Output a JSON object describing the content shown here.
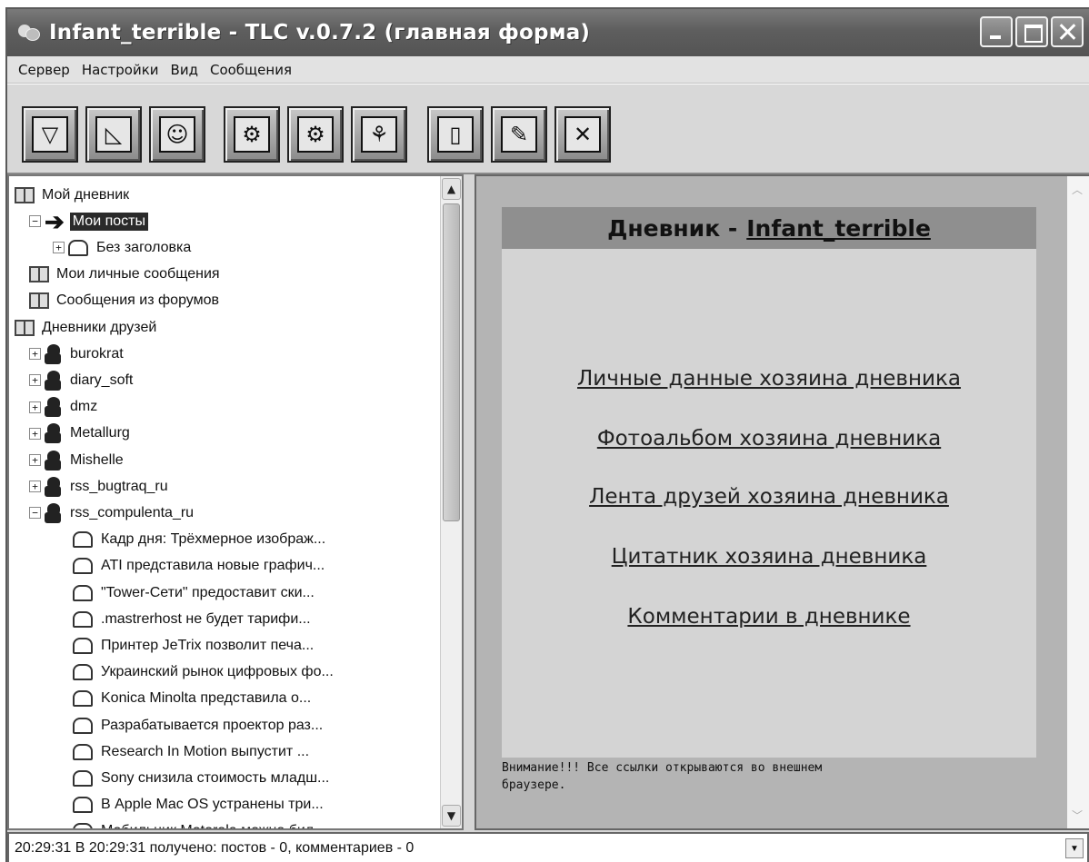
{
  "window": {
    "title": "Infant_terrible - TLC v.0.7.2 (главная форма)"
  },
  "menubar": {
    "items": [
      "Сервер",
      "Настройки",
      "Вид",
      "Сообщения"
    ]
  },
  "toolbar": {
    "buttons": [
      {
        "icon": "trash-icon",
        "glyph": "▽"
      },
      {
        "icon": "chart-icon",
        "glyph": "◺"
      },
      {
        "icon": "smiley-icon",
        "glyph": "☺"
      },
      {
        "icon": "settings-gears-icon",
        "glyph": "⚙"
      },
      {
        "icon": "settings-disk-icon",
        "glyph": "⚙"
      },
      {
        "icon": "users-icon",
        "glyph": "⚘"
      },
      {
        "icon": "new-document-icon",
        "glyph": "▯"
      },
      {
        "icon": "edit-document-icon",
        "glyph": "✎"
      },
      {
        "icon": "tools-icon",
        "glyph": "✕"
      }
    ]
  },
  "tree": {
    "items": [
      {
        "label": "Мой дневник",
        "icon": "book-icon",
        "level": 0,
        "expander": ""
      },
      {
        "label": "Мои посты",
        "icon": "arrow-icon",
        "level": 1,
        "expander": "−",
        "selected": true
      },
      {
        "label": "Без заголовка",
        "icon": "envelope-icon",
        "level": 2,
        "expander": "+"
      },
      {
        "label": "Мои личные сообщения",
        "icon": "book-icon",
        "level": 1,
        "expander": ""
      },
      {
        "label": "Сообщения из форумов",
        "icon": "book-icon",
        "level": 1,
        "expander": ""
      },
      {
        "label": "Дневники друзей",
        "icon": "book-icon",
        "level": 0,
        "expander": ""
      },
      {
        "label": "burokrat",
        "icon": "user-icon",
        "level": 1,
        "expander": "+"
      },
      {
        "label": "diary_soft",
        "icon": "user-icon",
        "level": 1,
        "expander": "+"
      },
      {
        "label": "dmz",
        "icon": "user-icon",
        "level": 1,
        "expander": "+"
      },
      {
        "label": "Metallurg",
        "icon": "user-icon",
        "level": 1,
        "expander": "+"
      },
      {
        "label": "Mishelle",
        "icon": "user-icon",
        "level": 1,
        "expander": "+"
      },
      {
        "label": "rss_bugtraq_ru",
        "icon": "user-icon",
        "level": 1,
        "expander": "+"
      },
      {
        "label": "rss_compulenta_ru",
        "icon": "user-icon",
        "level": 1,
        "expander": "−"
      },
      {
        "label": "Кадр дня: Трёхмерное изображ...",
        "icon": "envelope-icon",
        "level": 2,
        "expander": ""
      },
      {
        "label": "ATI представила новые графич...",
        "icon": "envelope-icon",
        "level": 2,
        "expander": ""
      },
      {
        "label": "\"Tower-Сети\" предоставит ски...",
        "icon": "envelope-icon",
        "level": 2,
        "expander": ""
      },
      {
        "label": ".mastrerhost не будет тарифи...",
        "icon": "envelope-icon",
        "level": 2,
        "expander": ""
      },
      {
        "label": "Принтер JeTrix позволит печа...",
        "icon": "envelope-icon",
        "level": 2,
        "expander": ""
      },
      {
        "label": "Украинский рынок цифровых фо...",
        "icon": "envelope-icon",
        "level": 2,
        "expander": ""
      },
      {
        "label": "Konica Minolta представила о...",
        "icon": "envelope-icon",
        "level": 2,
        "expander": ""
      },
      {
        "label": "Разрабатывается проектор раз...",
        "icon": "envelope-icon",
        "level": 2,
        "expander": ""
      },
      {
        "label": "Research In Motion выпустит ...",
        "icon": "envelope-icon",
        "level": 2,
        "expander": ""
      },
      {
        "label": "Sony снизила стоимость младш...",
        "icon": "envelope-icon",
        "level": 2,
        "expander": ""
      },
      {
        "label": "В Apple Mac OS устранены три...",
        "icon": "envelope-icon",
        "level": 2,
        "expander": ""
      },
      {
        "label": "Мобильник Motorola можно бил...",
        "icon": "envelope-icon",
        "level": 2,
        "expander": ""
      }
    ]
  },
  "diary": {
    "heading_prefix": "Дневник -",
    "owner": "Infant_terrible",
    "links": [
      "Личные данные хозяина дневника",
      "Фотоальбом хозяина дневника",
      "Лента друзей хозяина дневника",
      "Цитатник хозяина дневника",
      "Комментарии в дневнике"
    ],
    "notice_line1": "Внимание!!! Все ссылки открываются во внешнем",
    "notice_line2": "браузере."
  },
  "status": {
    "text": "20:29:31  В 20:29:31 получено: постов - 0, комментариев - 0"
  },
  "colors": {
    "titlebar": "#5e5e5e",
    "selection": "#2a2a2a",
    "diary_header": "#8f8f8f",
    "diary_bg": "#d4d4d4"
  }
}
